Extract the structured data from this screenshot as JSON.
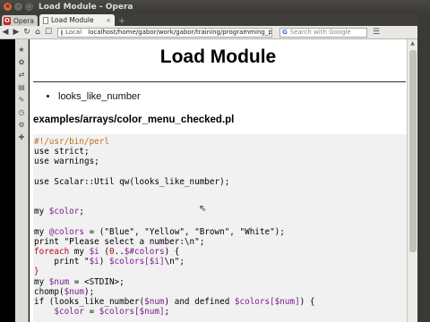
{
  "window": {
    "title": "Load Module - Opera",
    "minimize_glyph": "–",
    "maximize_glyph": "□",
    "close_glyph": "×"
  },
  "tabs": {
    "opera_label": "Opera",
    "opera_glyph": "O",
    "active_tab": "Load Module",
    "close_glyph": "×",
    "new_tab_glyph": "+"
  },
  "toolbar": {
    "back_glyph": "◀",
    "forward_glyph": "▶",
    "reload_glyph": "↻",
    "home_glyph": "⌂",
    "bookmark_glyph": "☐",
    "address_scope": "Local",
    "url": "localhost/home/gabor/work/gabor/training/programming_pe",
    "search_engine_glyph": "G",
    "search_placeholder": "Search with Google",
    "menu_glyph": "☰"
  },
  "sidebar_icons": [
    "★",
    "✿",
    "⇄",
    "▤",
    "✎",
    "◷",
    "⚙",
    "✚"
  ],
  "scrollbar": {
    "up_glyph": "▲",
    "down_glyph": "▼"
  },
  "page": {
    "title": "Load Module",
    "bullets": [
      "looks_like_number"
    ],
    "file_heading": "examples/arrays/color_menu_checked.pl",
    "code_lines": [
      {
        "parts": [
          {
            "t": "#!/usr/bin/perl",
            "c": "#c07020"
          }
        ]
      },
      {
        "parts": [
          {
            "t": "use strict;",
            "c": "#000000"
          }
        ]
      },
      {
        "parts": [
          {
            "t": "use warnings;",
            "c": "#000000"
          }
        ]
      },
      {
        "parts": [
          {
            "t": "",
            "c": "#000000"
          }
        ]
      },
      {
        "parts": [
          {
            "t": "use Scalar::Util qw(looks_like_number);",
            "c": "#000000"
          }
        ]
      },
      {
        "parts": [
          {
            "t": "",
            "c": "#000000"
          }
        ]
      },
      {
        "parts": [
          {
            "t": "",
            "c": "#000000"
          }
        ]
      },
      {
        "parts": [
          {
            "t": "my ",
            "c": "#000000"
          },
          {
            "t": "$color",
            "c": "#7a1f8a"
          },
          {
            "t": ";",
            "c": "#000000"
          }
        ]
      },
      {
        "parts": [
          {
            "t": "",
            "c": "#000000"
          }
        ]
      },
      {
        "parts": [
          {
            "t": "my ",
            "c": "#000000"
          },
          {
            "t": "@colors",
            "c": "#7a1f8a"
          },
          {
            "t": " = (\"Blue\", \"Yellow\", \"Brown\", \"White\");",
            "c": "#000000"
          }
        ]
      },
      {
        "parts": [
          {
            "t": "print \"Please select a number:\\n\";",
            "c": "#000000"
          }
        ]
      },
      {
        "parts": [
          {
            "t": "foreach",
            "c": "#b8001c"
          },
          {
            "t": " my ",
            "c": "#000000"
          },
          {
            "t": "$i",
            "c": "#7a1f8a"
          },
          {
            "t": " (",
            "c": "#000000"
          },
          {
            "t": "0",
            "c": "#b8001c"
          },
          {
            "t": "..",
            "c": "#000000"
          },
          {
            "t": "$#colors",
            "c": "#7a1f8a"
          },
          {
            "t": ") {",
            "c": "#000000"
          }
        ]
      },
      {
        "parts": [
          {
            "t": "    print \"",
            "c": "#000000"
          },
          {
            "t": "$i",
            "c": "#7a1f8a"
          },
          {
            "t": ") ",
            "c": "#000000"
          },
          {
            "t": "$colors[$i]",
            "c": "#7a1f8a"
          },
          {
            "t": "\\n\";",
            "c": "#000000"
          }
        ]
      },
      {
        "parts": [
          {
            "t": "}",
            "c": "#b8001c"
          }
        ]
      },
      {
        "parts": [
          {
            "t": "my ",
            "c": "#000000"
          },
          {
            "t": "$num",
            "c": "#7a1f8a"
          },
          {
            "t": " = <STDIN>;",
            "c": "#000000"
          }
        ]
      },
      {
        "parts": [
          {
            "t": "chomp(",
            "c": "#000000"
          },
          {
            "t": "$num",
            "c": "#7a1f8a"
          },
          {
            "t": ");",
            "c": "#000000"
          }
        ]
      },
      {
        "parts": [
          {
            "t": "if (looks_like_number(",
            "c": "#000000"
          },
          {
            "t": "$num",
            "c": "#7a1f8a"
          },
          {
            "t": ") and defined ",
            "c": "#000000"
          },
          {
            "t": "$colors[$num]",
            "c": "#7a1f8a"
          },
          {
            "t": ") {",
            "c": "#000000"
          }
        ]
      },
      {
        "parts": [
          {
            "t": "    ",
            "c": "#000000"
          },
          {
            "t": "$color",
            "c": "#7a1f8a"
          },
          {
            "t": " = ",
            "c": "#000000"
          },
          {
            "t": "$colors[$num]",
            "c": "#7a1f8a"
          },
          {
            "t": ";",
            "c": "#000000"
          }
        ]
      }
    ]
  },
  "mouse_cursor_glyph": "⇖"
}
